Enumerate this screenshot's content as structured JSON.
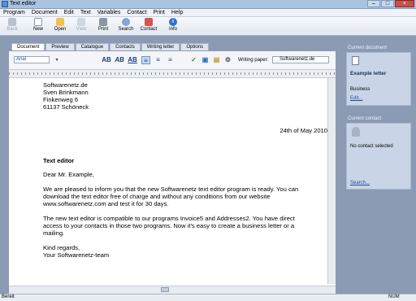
{
  "window": {
    "title": "Text editor"
  },
  "menu": [
    "Program",
    "Document",
    "Edit",
    "Text",
    "Variables",
    "Contact",
    "Print",
    "Help"
  ],
  "toolbar": {
    "back": "Back",
    "new": "New",
    "open": "Open",
    "view": "View",
    "print": "Print",
    "search": "Search",
    "contact": "Contact",
    "info": "Info"
  },
  "tabs": [
    "Document",
    "Preview",
    "Catalogue",
    "Contacts",
    "Writing letter",
    "Options"
  ],
  "format": {
    "font_value": "Arial",
    "writing_paper_label": "Writing paper:",
    "writing_paper_value": "Softwarenetz.de"
  },
  "document": {
    "address": [
      "Softwarenetz.de",
      "Sven Brinkmann",
      "Finkenweg 6",
      "61137 Schöneck"
    ],
    "date": "24th of May 2010",
    "subject": "Text editor",
    "salutation": "Dear Mr. Example,",
    "para1": [
      "We are pleased to inform you that the new Softwarenetz text editor program is ready. You can",
      "download the text editor free of charge and without any conditions from our website",
      "www.softwarenetz.com and test it for 30 days."
    ],
    "para2": [
      "The new text editor is compatible to our programs Invoice5 and Addresses2. You have direct",
      "access to your contacts in those two programs. Now it's easy to create a business letter or a",
      "mailing."
    ],
    "closing": [
      "Kind regards,",
      "Your Softwarenetz-team"
    ]
  },
  "current_document": {
    "header": "Current document",
    "name": "Example letter",
    "category": "Business",
    "edit_link": "Edit..."
  },
  "current_contact": {
    "header": "Current contact",
    "status": "No contact selected",
    "search_link": "Search..."
  },
  "status": {
    "left": "Bereit",
    "right": "NUM"
  },
  "colors": {
    "accent": "#1a4d9c",
    "background": "#8a9bb3",
    "panel": "#c9d5e6"
  }
}
